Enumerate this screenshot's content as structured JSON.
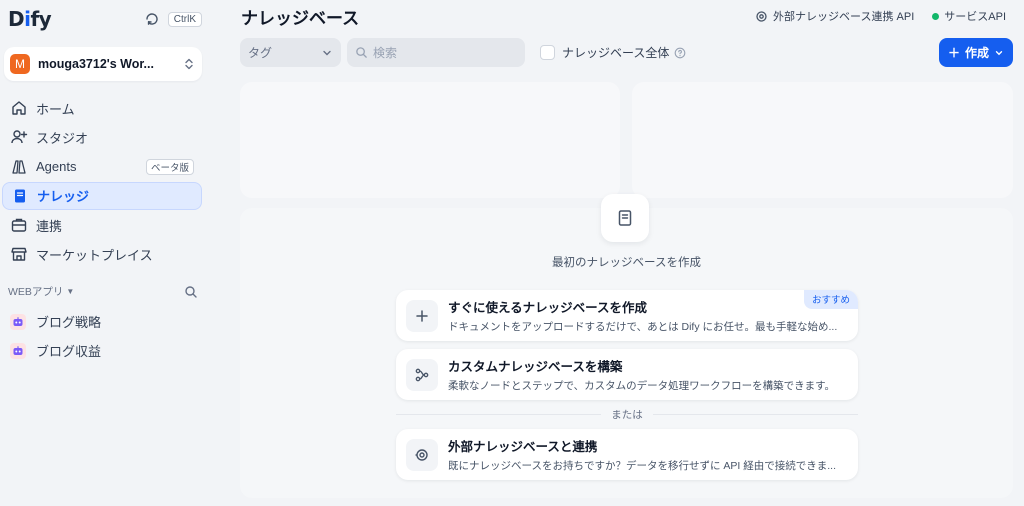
{
  "brand": {
    "logo_prefix": "D",
    "logo_i": "i",
    "logo_suffix": "fy",
    "shortcut": "CtrlK",
    "accent": "#155eef"
  },
  "workspace": {
    "initial": "M",
    "name": "mouga3712's Wor...",
    "avatar_color": "#ef6820"
  },
  "nav": {
    "home": "ホーム",
    "studio": "スタジオ",
    "agents": "Agents",
    "agents_badge": "ベータ版",
    "knowledge": "ナレッジ",
    "integrations": "連携",
    "marketplace": "マーケットプレイス"
  },
  "webapps": {
    "heading": "WEBアプリ",
    "items": [
      {
        "name": "ブログ戦略"
      },
      {
        "name": "ブログ収益"
      }
    ]
  },
  "header": {
    "title": "ナレッジベース",
    "external_api": "外部ナレッジベース連携 API",
    "service_api": "サービスAPI"
  },
  "toolbar": {
    "tag_placeholder": "タグ",
    "search_placeholder": "検索",
    "all_knowledge_label": "ナレッジベース全体",
    "create_label": "作成"
  },
  "empty_state": {
    "message": "最初のナレッジベースを作成",
    "or_label": "または",
    "options": [
      {
        "title": "すぐに使えるナレッジベースを作成",
        "desc": "ドキュメントをアップロードするだけで、あとは Dify にお任せ。最も手軽な始め...",
        "badge": "おすすめ"
      },
      {
        "title": "カスタムナレッジベースを構築",
        "desc": "柔軟なノードとステップで、カスタムのデータ処理ワークフローを構築できます。"
      },
      {
        "title": "外部ナレッジベースと連携",
        "desc": "既にナレッジベースをお持ちですか？データを移行せずに API 経由で接続できま..."
      }
    ]
  }
}
